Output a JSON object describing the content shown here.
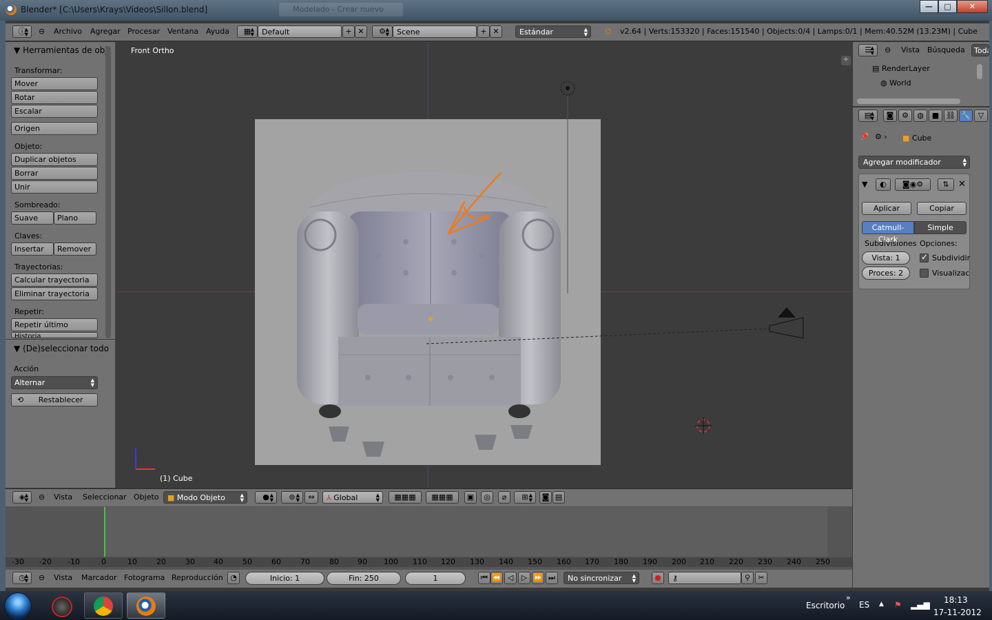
{
  "window": {
    "title": "Blender* [C:\\Users\\Krays\\Videos\\Sillon.blend]",
    "background_tab": "Modelado - Crear nuevo",
    "controls": {
      "minimize": "—",
      "maximize": "□",
      "close": "✕"
    }
  },
  "top_menu": {
    "info_icon": "info-icon",
    "items": [
      "Archivo",
      "Agregar",
      "Procesar",
      "Ventana",
      "Ayuda"
    ],
    "layout_value": "Default",
    "scene_value": "Scene",
    "render_engine": "Estándar",
    "stats": "v2.64 | Verts:153320 | Faces:151540 | Objects:0/4 | Lamps:0/1 | Mem:40.52M (13.23M) | Cube"
  },
  "tool_panel": {
    "title": "Herramientas de obj",
    "sections": [
      {
        "label": "Transformar:",
        "buttons": [
          "Mover",
          "Rotar",
          "Escalar"
        ]
      },
      {
        "label": "",
        "buttons": [
          "Origen"
        ]
      },
      {
        "label": "Objeto:",
        "buttons": [
          "Duplicar objetos",
          "Borrar",
          "Unir"
        ]
      },
      {
        "label": "Sombreado:",
        "pair": [
          "Suave",
          "Plano"
        ]
      },
      {
        "label": "Claves:",
        "pair": [
          "Insertar",
          "Remover"
        ]
      },
      {
        "label": "Trayectorias:",
        "buttons": [
          "Calcular trayectoria",
          "Eliminar trayectoria"
        ]
      },
      {
        "label": "Repetir:",
        "buttons": [
          "Repetir último",
          "Historia"
        ]
      }
    ],
    "operator_panel": {
      "title": "(De)seleccionar todo",
      "action_label": "Acción",
      "action_value": "Alternar",
      "reset_label": "Restablecer"
    }
  },
  "viewport": {
    "view_name": "Front Ortho",
    "object_label": "(1) Cube"
  },
  "viewport_header": {
    "menus": [
      "Vista",
      "Seleccionar",
      "Objeto"
    ],
    "mode": "Modo Objeto",
    "orientation": "Global"
  },
  "timeline": {
    "ticks": [
      "-30",
      "-20",
      "-10",
      "0",
      "10",
      "20",
      "30",
      "40",
      "50",
      "60",
      "70",
      "80",
      "90",
      "100",
      "110",
      "120",
      "130",
      "140",
      "150",
      "160",
      "170",
      "180",
      "190",
      "200",
      "210",
      "220",
      "230",
      "240",
      "250"
    ],
    "menus": [
      "Vista",
      "Marcador",
      "Fotograma",
      "Reproducción"
    ],
    "start": "Inicio: 1",
    "end": "Fin: 250",
    "current": "1",
    "sync": "No sincronizar"
  },
  "outliner": {
    "menus": [
      "Vista",
      "Búsqueda",
      "Toda"
    ],
    "items": [
      "RenderLayer",
      "World"
    ]
  },
  "properties": {
    "object_name": "Cube",
    "add_modifier": "Agregar modificador",
    "apply": "Aplicar",
    "copy": "Copiar",
    "type_a": "Catmull-Clark",
    "type_b": "Simple",
    "subdiv_label": "Subdivisiones",
    "options_label": "Opciones:",
    "view_levels": "Vista: 1",
    "render_levels": "Proces: 2",
    "opt_subdivide": "Subdividir",
    "opt_display": "Visualizac"
  },
  "taskbar": {
    "desktop": "Escritorio",
    "language": "ES",
    "time": "18:13",
    "date": "17-11-2012",
    "overflow": "»"
  },
  "colors": {
    "blender_gray": "#727272",
    "viewport": "#3c3c3c",
    "selection_blue": "#5680c2",
    "annotation_orange": "#f07a1a"
  }
}
